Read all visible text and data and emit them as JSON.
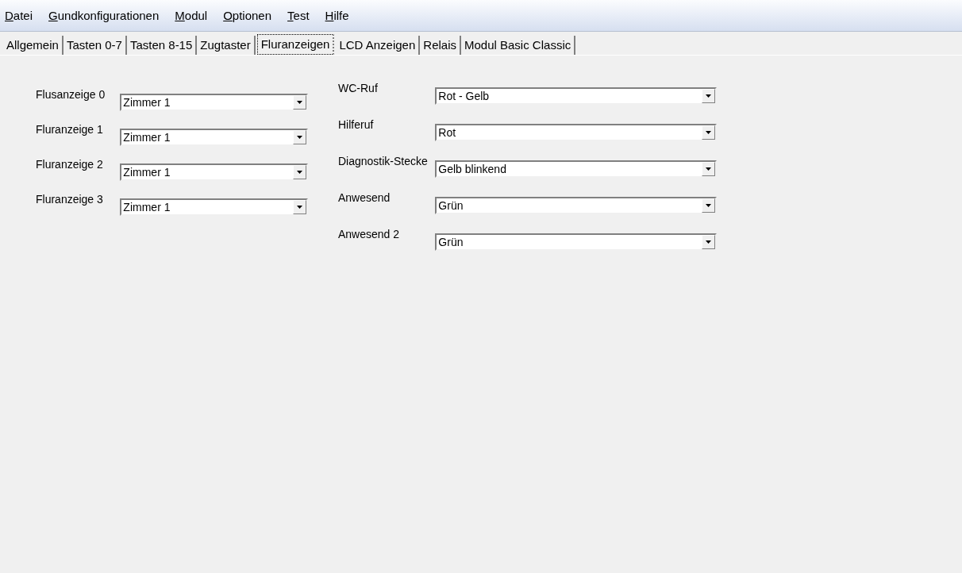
{
  "menu": [
    "Datei",
    "Gundkonfigurationen",
    "Modul",
    "Optionen",
    "Test",
    "Hilfe"
  ],
  "tabs": [
    {
      "label": "Allgemein",
      "selected": false
    },
    {
      "label": "Tasten 0-7",
      "selected": false
    },
    {
      "label": "Tasten 8-15",
      "selected": false
    },
    {
      "label": "Zugtaster",
      "selected": false
    },
    {
      "label": "Fluranzeigen",
      "selected": true
    },
    {
      "label": "LCD Anzeigen",
      "selected": false
    },
    {
      "label": "Relais",
      "selected": false
    },
    {
      "label": "Modul Basic Classic",
      "selected": false
    }
  ],
  "left_fields": [
    {
      "label": "Flusanzeige 0",
      "value": "Zimmer 1"
    },
    {
      "label": "Fluranzeige 1",
      "value": "Zimmer 1"
    },
    {
      "label": "Fluranzeige 2",
      "value": "Zimmer 1"
    },
    {
      "label": "Fluranzeige 3",
      "value": "Zimmer 1"
    }
  ],
  "right_fields": [
    {
      "label": "WC-Ruf",
      "value": "Rot - Gelb"
    },
    {
      "label": "Hilferuf",
      "value": "Rot"
    },
    {
      "label": "Diagnostik-Stecke",
      "value": "Gelb blinkend"
    },
    {
      "label": "Anwesend",
      "value": "Grün"
    },
    {
      "label": "Anwesend 2",
      "value": "Grün"
    }
  ]
}
